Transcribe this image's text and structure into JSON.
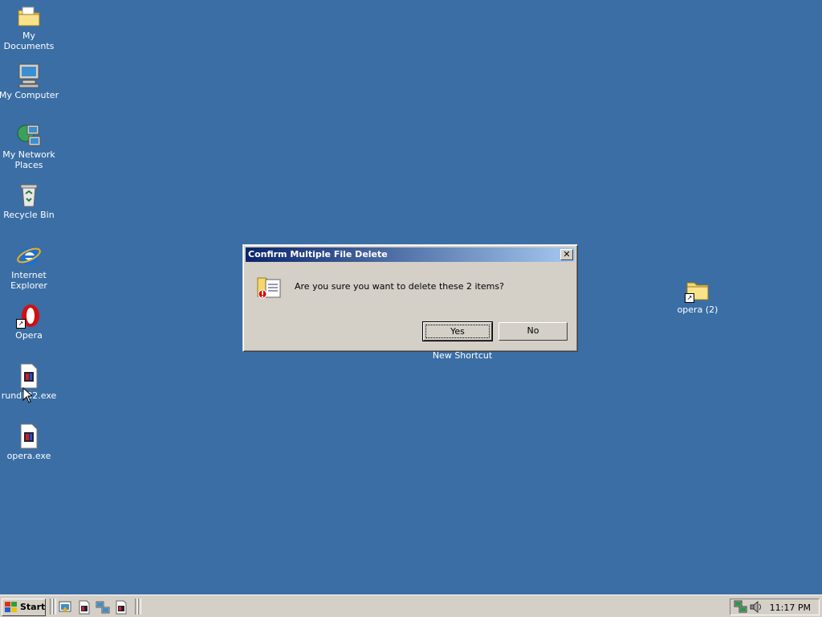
{
  "desktop": {
    "icons": [
      {
        "label": "My Documents"
      },
      {
        "label": "My Computer"
      },
      {
        "label": "My Network Places"
      },
      {
        "label": "Recycle Bin"
      },
      {
        "label": "Internet Explorer"
      },
      {
        "label": "Opera"
      },
      {
        "label": "rundll32.exe"
      },
      {
        "label": "opera.exe"
      },
      {
        "label": "opera (2)"
      },
      {
        "label": "New Shortcut"
      }
    ]
  },
  "dialog": {
    "title": "Confirm Multiple File Delete",
    "message": "Are you sure you want to delete these 2 items?",
    "yes_label": "Yes",
    "no_label": "No",
    "close_glyph": "✕"
  },
  "taskbar": {
    "start_label": "Start",
    "clock": "11:17 PM"
  }
}
